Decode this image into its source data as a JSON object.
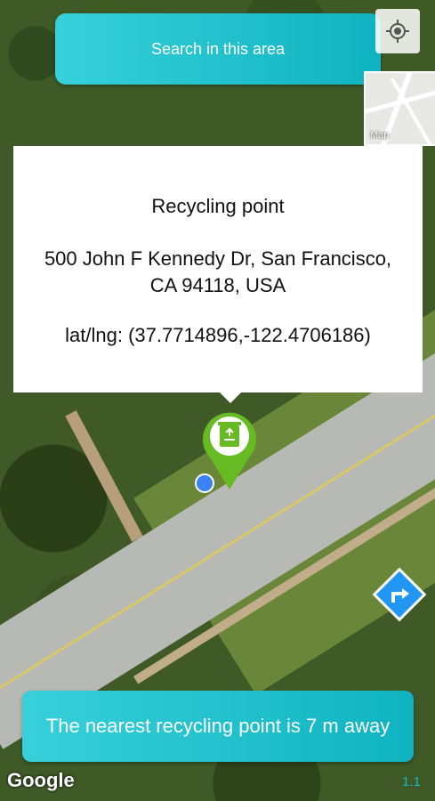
{
  "search": {
    "label": "Search in this area"
  },
  "map_type": {
    "label": "Map"
  },
  "info_window": {
    "title": "Recycling point",
    "address": "500 John F Kennedy Dr, San Francisco, CA 94118, USA",
    "coords": "lat/lng: (37.7714896,-122.4706186)"
  },
  "status": {
    "nearest": "The nearest recycling point is 7 m away"
  },
  "attribution": "Google",
  "version": "1.1",
  "colors": {
    "accent": "#1fc0cb",
    "marker": "#66bb22",
    "location_dot": "#3b82f6",
    "direction": "#2196f3"
  },
  "icons": [
    "crosshair-icon",
    "recycle-icon",
    "turn-right-icon"
  ]
}
